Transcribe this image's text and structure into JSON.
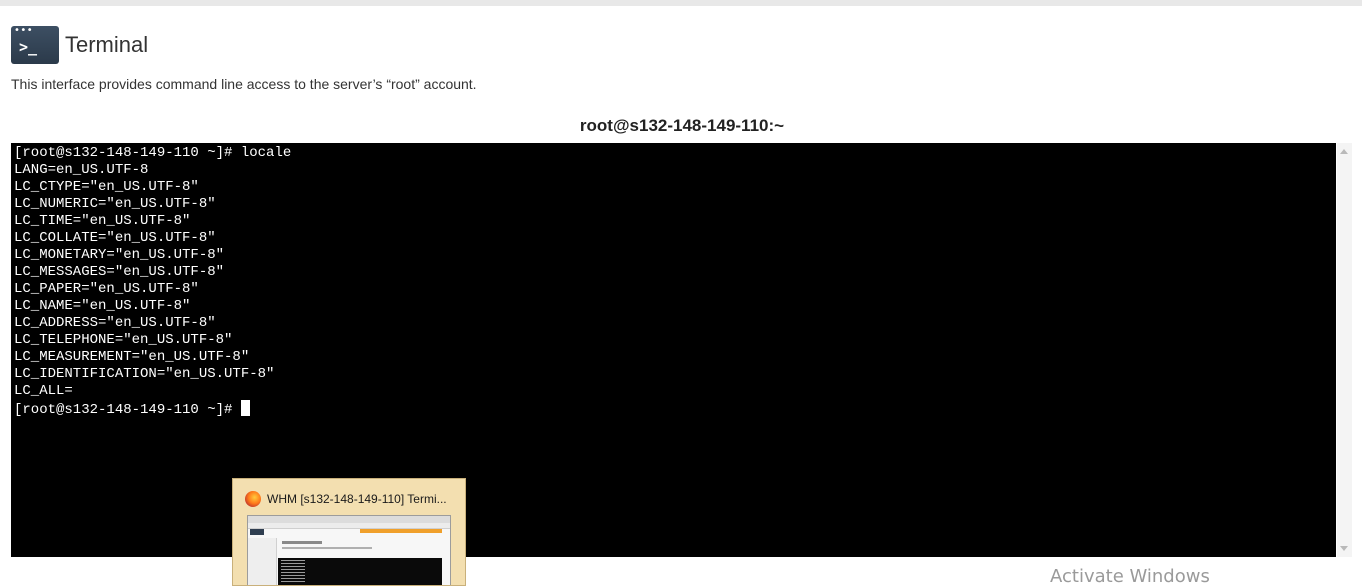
{
  "header": {
    "icon": "terminal-icon",
    "icon_prompt": ">_",
    "title": "Terminal"
  },
  "description": "This interface provides command line access to the server’s “root” account.",
  "session": {
    "title": "root@s132-148-149-110:~"
  },
  "terminal": {
    "lines": [
      "[root@s132-148-149-110 ~]# locale",
      "LANG=en_US.UTF-8",
      "LC_CTYPE=\"en_US.UTF-8\"",
      "LC_NUMERIC=\"en_US.UTF-8\"",
      "LC_TIME=\"en_US.UTF-8\"",
      "LC_COLLATE=\"en_US.UTF-8\"",
      "LC_MONETARY=\"en_US.UTF-8\"",
      "LC_MESSAGES=\"en_US.UTF-8\"",
      "LC_PAPER=\"en_US.UTF-8\"",
      "LC_NAME=\"en_US.UTF-8\"",
      "LC_ADDRESS=\"en_US.UTF-8\"",
      "LC_TELEPHONE=\"en_US.UTF-8\"",
      "LC_MEASUREMENT=\"en_US.UTF-8\"",
      "LC_IDENTIFICATION=\"en_US.UTF-8\"",
      "LC_ALL="
    ],
    "prompt": "[root@s132-148-149-110 ~]# "
  },
  "taskbar_preview": {
    "icon": "firefox-icon",
    "title": "WHM [s132-148-149-110] Termi..."
  },
  "watermark": "Activate Windows",
  "colors": {
    "terminal_bg": "#000000",
    "terminal_fg": "#ffffff",
    "icon_bg": "#2b3a4a",
    "preview_bg": "#f3dfb0"
  }
}
